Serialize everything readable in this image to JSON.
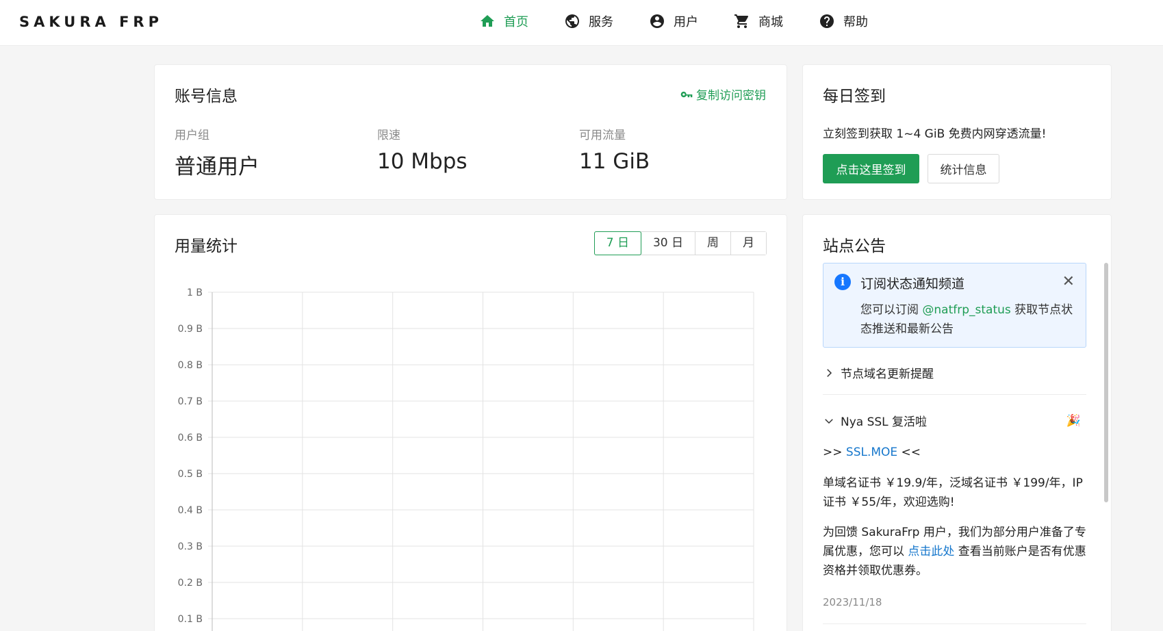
{
  "brand": "SAKURA FRP",
  "nav": [
    {
      "label": "首页",
      "icon": "home-icon",
      "active": true
    },
    {
      "label": "服务",
      "icon": "globe-icon"
    },
    {
      "label": "用户",
      "icon": "user-circle-icon"
    },
    {
      "label": "商城",
      "icon": "cart-icon"
    },
    {
      "label": "帮助",
      "icon": "help-icon"
    }
  ],
  "account": {
    "title": "账号信息",
    "copy_key": "复制访问密钥",
    "stats": [
      {
        "label": "用户组",
        "value": "普通用户"
      },
      {
        "label": "限速",
        "value": "10 Mbps"
      },
      {
        "label": "可用流量",
        "value": "11 GiB"
      }
    ]
  },
  "signin": {
    "title": "每日签到",
    "text": "立刻签到获取 1~4 GiB 免费内网穿透流量!",
    "sign_button": "点击这里签到",
    "stats_button": "统计信息"
  },
  "usage": {
    "title": "用量统计",
    "ranges": [
      "7 日",
      "30 日",
      "周",
      "月"
    ],
    "active_range": "7 日"
  },
  "chart_data": {
    "type": "line",
    "title": "",
    "xlabel": "",
    "ylabel": "",
    "y_ticks": [
      "1 B",
      "0.9 B",
      "0.8 B",
      "0.7 B",
      "0.6 B",
      "0.5 B",
      "0.4 B",
      "0.3 B",
      "0.2 B",
      "0.1 B"
    ],
    "ylim": [
      0,
      1
    ],
    "x_grid_columns": 6,
    "series": [],
    "grid": true
  },
  "notice": {
    "title": "站点公告",
    "alert": {
      "title": "订阅状态通知频道",
      "close": "✕",
      "body_before": "您可以订阅 ",
      "link": "@natfrp_status",
      "body_after": " 获取节点状态推送和最新公告"
    },
    "items": [
      {
        "title": "节点域名更新提醒",
        "expanded": false
      },
      {
        "title": "Nya SSL 复活啦",
        "expanded": true,
        "emoji": "🎉"
      }
    ],
    "ssl_prefix": ">> ",
    "ssl_link": "SSL.MOE",
    "ssl_suffix": " <<",
    "price_text": "单域名证书 ￥19.9/年，泛域名证书 ￥199/年，IP 证书 ￥55/年，欢迎选购!",
    "promo_before": "为回馈 SakuraFrp 用户，我们为部分用户准备了专属优惠，您可以 ",
    "promo_link": "点击此处",
    "promo_after": " 查看当前账户是否有优惠资格并领取优惠券。",
    "date": "2023/11/18"
  },
  "colors": {
    "accent": "#1f9d55",
    "link": "#1677cc",
    "info": "#1677ff"
  }
}
